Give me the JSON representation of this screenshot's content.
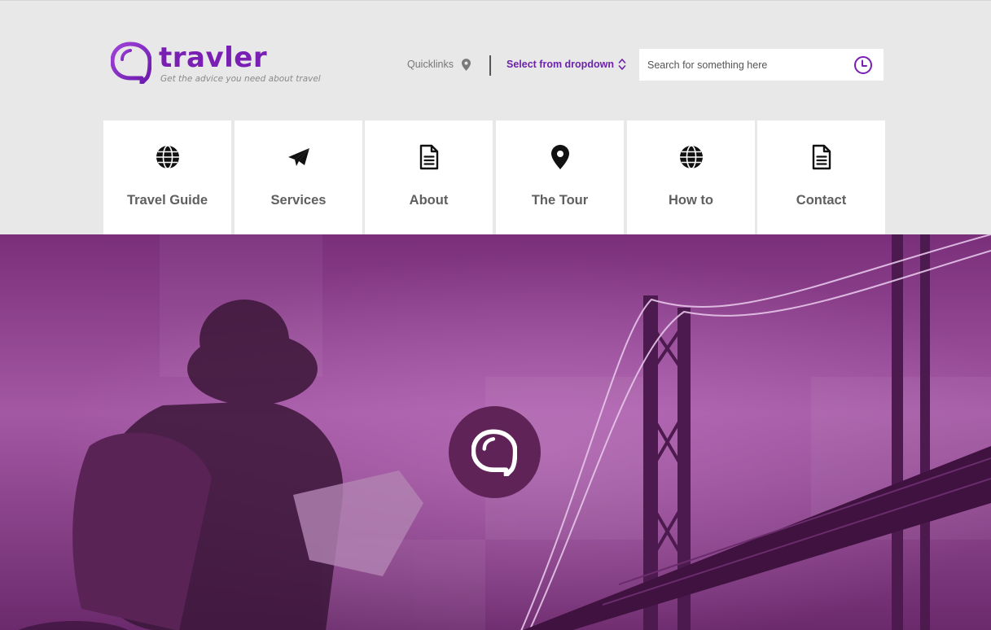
{
  "brand": {
    "name": "travler",
    "tagline": "Get the advice you need about travel",
    "accent_color": "#7a1fb4",
    "logo_icon": "speech-bubble-icon"
  },
  "topbar": {
    "quicklinks_label": "Quicklinks",
    "quicklinks_icon": "map-pin-icon",
    "dropdown_label": "Select from dropdown",
    "dropdown_icon": "chevron-up-down-icon"
  },
  "search": {
    "placeholder": "Search for something here",
    "value": "",
    "button_icon": "clock-icon"
  },
  "nav": {
    "items": [
      {
        "label": "Travel Guide",
        "icon": "globe-icon"
      },
      {
        "label": "Services",
        "icon": "paper-plane-icon"
      },
      {
        "label": "About",
        "icon": "document-icon"
      },
      {
        "label": "The Tour",
        "icon": "map-pin-icon"
      },
      {
        "label": "How to",
        "icon": "globe-icon"
      },
      {
        "label": "Contact",
        "icon": "document-icon"
      }
    ],
    "active_index": 3
  },
  "hero": {
    "image": "traveler with backpack and map near suspension bridge, purple tint",
    "center_icon": "speech-bubble-icon",
    "tint_color": "#873b86"
  }
}
